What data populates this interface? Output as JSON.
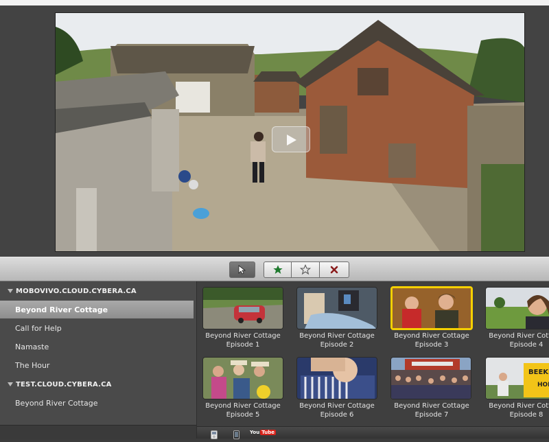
{
  "toolbar": {
    "buttons": [
      {
        "name": "select-tool-button",
        "icon": "cursor-arrow-icon"
      },
      {
        "name": "favorite-button",
        "icon": "filled-star-icon"
      },
      {
        "name": "unfavorite-button",
        "icon": "outline-star-icon"
      },
      {
        "name": "reject-button",
        "icon": "x-mark-icon"
      }
    ]
  },
  "sidebar": {
    "groups": [
      {
        "label": "MOBOVIVO.CLOUD.CYBERA.CA",
        "items": [
          "Beyond River Cottage",
          "Call for Help",
          "Namaste",
          "The Hour"
        ]
      },
      {
        "label": "TEST.CLOUD.CYBERA.CA",
        "items": [
          "Beyond River Cottage"
        ]
      }
    ],
    "selected": "Beyond River Cottage"
  },
  "episodes": [
    {
      "title": "Beyond River Cottage",
      "episode": "Episode 1"
    },
    {
      "title": "Beyond River Cottage",
      "episode": "Episode 2"
    },
    {
      "title": "Beyond River Cottage",
      "episode": "Episode 3"
    },
    {
      "title": "Beyond River Cottage",
      "episode": "Episode 4"
    },
    {
      "title": "Beyond River Cottage",
      "episode": "Episode 5"
    },
    {
      "title": "Beyond River Cottage",
      "episode": "Episode 6"
    },
    {
      "title": "Beyond River Cottage",
      "episode": "Episode 7"
    },
    {
      "title": "Beyond River Cottage",
      "episode": "Episode 8"
    }
  ],
  "selected_episode": "Episode 3",
  "bottom_bar": {
    "icons": [
      "ipod-icon",
      "iphone-icon",
      "youtube-icon"
    ],
    "youtube_label": "You Tube"
  },
  "colors": {
    "selection_border": "#f5d000",
    "star_green": "#1f7a2e",
    "reject_red": "#a31f1f"
  }
}
